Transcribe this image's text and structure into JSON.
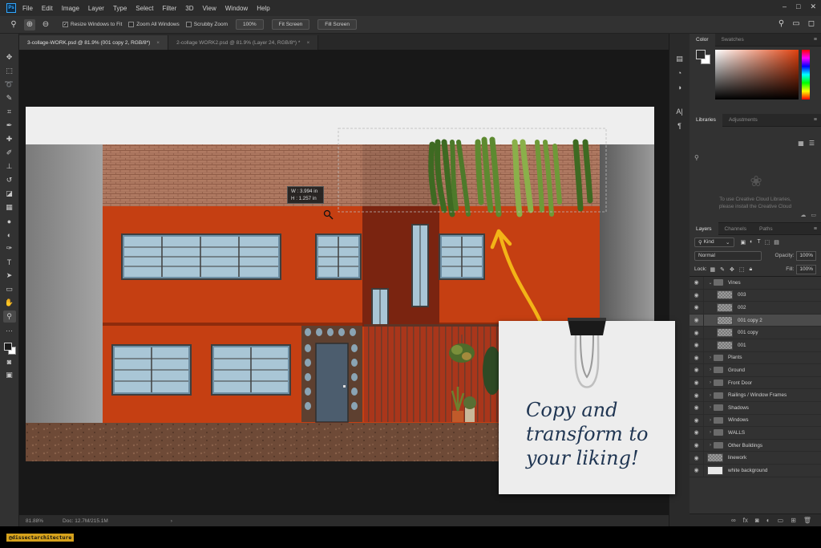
{
  "menubar": {
    "logo": "Ps",
    "items": [
      "File",
      "Edit",
      "Image",
      "Layer",
      "Type",
      "Select",
      "Filter",
      "3D",
      "View",
      "Window",
      "Help"
    ],
    "window_controls": [
      "–",
      "□",
      "✕"
    ]
  },
  "options": {
    "resize_windows_label": "Resize Windows to Fit",
    "resize_windows_checked": true,
    "zoom_all_label": "Zoom All Windows",
    "scrubby_label": "Scrubby Zoom",
    "zoom_value": "100%",
    "fit_screen": "Fit Screen",
    "fill_screen": "Fill Screen"
  },
  "tabs": [
    {
      "label": "3-collage-WORK.psd @ 81.9% (001 copy 2, RGB/8*)",
      "close": "×"
    },
    {
      "label": "2-collage WORK2.psd @ 81.9% (Layer 24, RGB/8*) *",
      "close": "×"
    }
  ],
  "status": {
    "zoom": "81.88%",
    "doc": "Doc: 12.7M/215.1M",
    "arrow": "›"
  },
  "canvas": {
    "transform_w": "W : 3.994 in",
    "transform_h": "H : 1.257 in"
  },
  "panels": {
    "color_tabs": [
      "Color",
      "Swatches"
    ],
    "library_tabs": [
      "Libraries",
      "Adjustments"
    ],
    "library_msg1": "To use Creative Cloud Libraries,",
    "library_msg2": "please install the Creative Cloud",
    "layer_tabs": [
      "Layers",
      "Channels",
      "Paths"
    ],
    "kind_label": "Kind",
    "blend_mode": "Normal",
    "opacity_label": "Opacity:",
    "opacity_value": "100%",
    "lock_label": "Lock:",
    "fill_label": "Fill:",
    "fill_value": "100%"
  },
  "layers": [
    {
      "name": "Vines",
      "type": "group",
      "expanded": true
    },
    {
      "name": "003",
      "type": "layer"
    },
    {
      "name": "002",
      "type": "layer"
    },
    {
      "name": "001 copy 2",
      "type": "layer",
      "selected": true
    },
    {
      "name": "001 copy",
      "type": "layer"
    },
    {
      "name": "001",
      "type": "layer"
    },
    {
      "name": "Plants",
      "type": "group"
    },
    {
      "name": "Ground",
      "type": "group"
    },
    {
      "name": "Front Door",
      "type": "group"
    },
    {
      "name": "Railings / Window Frames",
      "type": "group"
    },
    {
      "name": "Shadows",
      "type": "group"
    },
    {
      "name": "Windows",
      "type": "group"
    },
    {
      "name": "WALLS",
      "type": "group"
    },
    {
      "name": "Other Buildings",
      "type": "group"
    },
    {
      "name": "linework",
      "type": "layer"
    },
    {
      "name": "white background",
      "type": "layer",
      "white": true
    }
  ],
  "note": {
    "line1": "Copy and",
    "line2": "transform to",
    "line3": "your liking!"
  },
  "watermark": "@dissectarchitecture",
  "colors": {
    "accent_arrow": "#f3b417",
    "wall_orange": "#c53f12",
    "note_text": "#1f3552"
  }
}
